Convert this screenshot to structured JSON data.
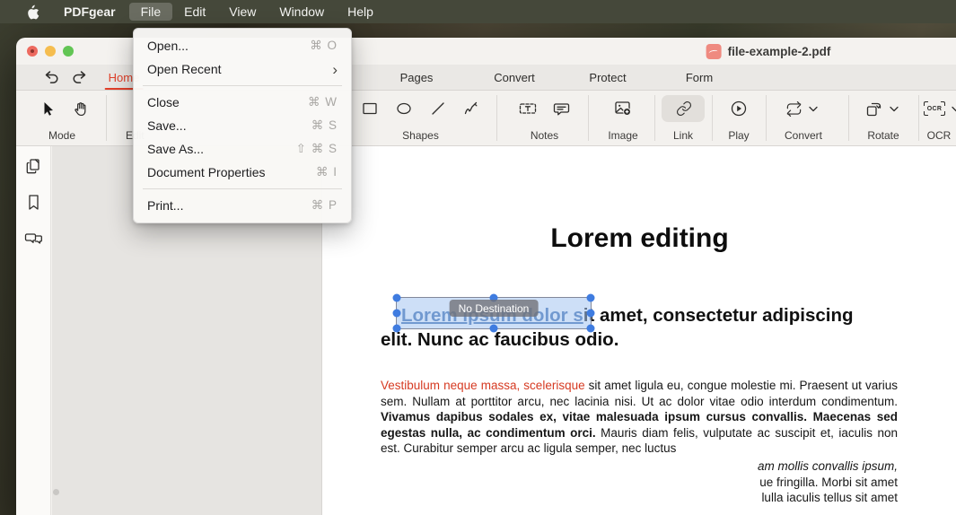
{
  "menubar": {
    "app_name": "PDFgear",
    "items": [
      "File",
      "Edit",
      "View",
      "Window",
      "Help"
    ],
    "active_item": "File"
  },
  "file_menu": {
    "items": [
      {
        "label": "Open...",
        "shortcut": "⌘ O"
      },
      {
        "label": "Open Recent",
        "shortcut": "›"
      },
      {
        "label": "Close",
        "shortcut": "⌘ W"
      },
      {
        "label": "Save...",
        "shortcut": "⌘ S"
      },
      {
        "label": "Save As...",
        "shortcut": "⇧ ⌘ S"
      },
      {
        "label": "Document Properties",
        "shortcut": "⌘ I"
      },
      {
        "label": "Print...",
        "shortcut": "⌘ P"
      }
    ]
  },
  "window": {
    "title": "file-example-2.pdf"
  },
  "tabs": {
    "items": [
      "Home",
      "Pages",
      "Convert",
      "Protect",
      "Form"
    ],
    "active": "Home"
  },
  "toolbar": {
    "groups": {
      "mode": "Mode",
      "edit": "Edit",
      "shapes": "Shapes",
      "notes": "Notes",
      "image": "Image",
      "link": "Link",
      "play": "Play",
      "convert": "Convert",
      "rotate": "Rotate",
      "ocr": "OCR"
    },
    "ocr_icon_text": "OCR"
  },
  "document": {
    "title": "Lorem editing",
    "subtitle": {
      "link_text": "Lorem ipsum dolor s",
      "line1_rest": "it amet, consectetur adipiscing",
      "line2": "elit. Nunc ac faucibus odio."
    },
    "selection_tooltip": "No Destination",
    "body": {
      "red_lead": "Vestibulum neque massa, scelerisque",
      "normal_1": " sit amet ligula eu, congue molestie mi. Praesent ut varius sem. Nullam at porttitor arcu, nec lacinia nisi. Ut ac dolor vitae odio interdum condimentum. ",
      "bold_mid": "Vivamus dapibus sodales ex, vitae malesuada ipsum cursus convallis. Maecenas sed egestas nulla, ac condimentum orci.",
      "normal_2": " Mauris diam felis, vulputate ac suscipit et, iaculis non est. Curabitur semper arcu ac ligula semper, nec luctus"
    },
    "erased_lines": [
      "am mollis convallis ipsum,",
      "ue fringilla. Morbi sit amet",
      "lulla iaculis tellus sit amet"
    ]
  },
  "colors": {
    "menubar_bg": "#45483a",
    "accent_red": "#e2402a",
    "link_blue": "#3465a8",
    "selection_fill": "#aac7ee",
    "handle_blue": "#3f7ce0",
    "traffic_red": "#ed6a5f",
    "traffic_yellow": "#f5bd4f",
    "traffic_green": "#62c554"
  }
}
